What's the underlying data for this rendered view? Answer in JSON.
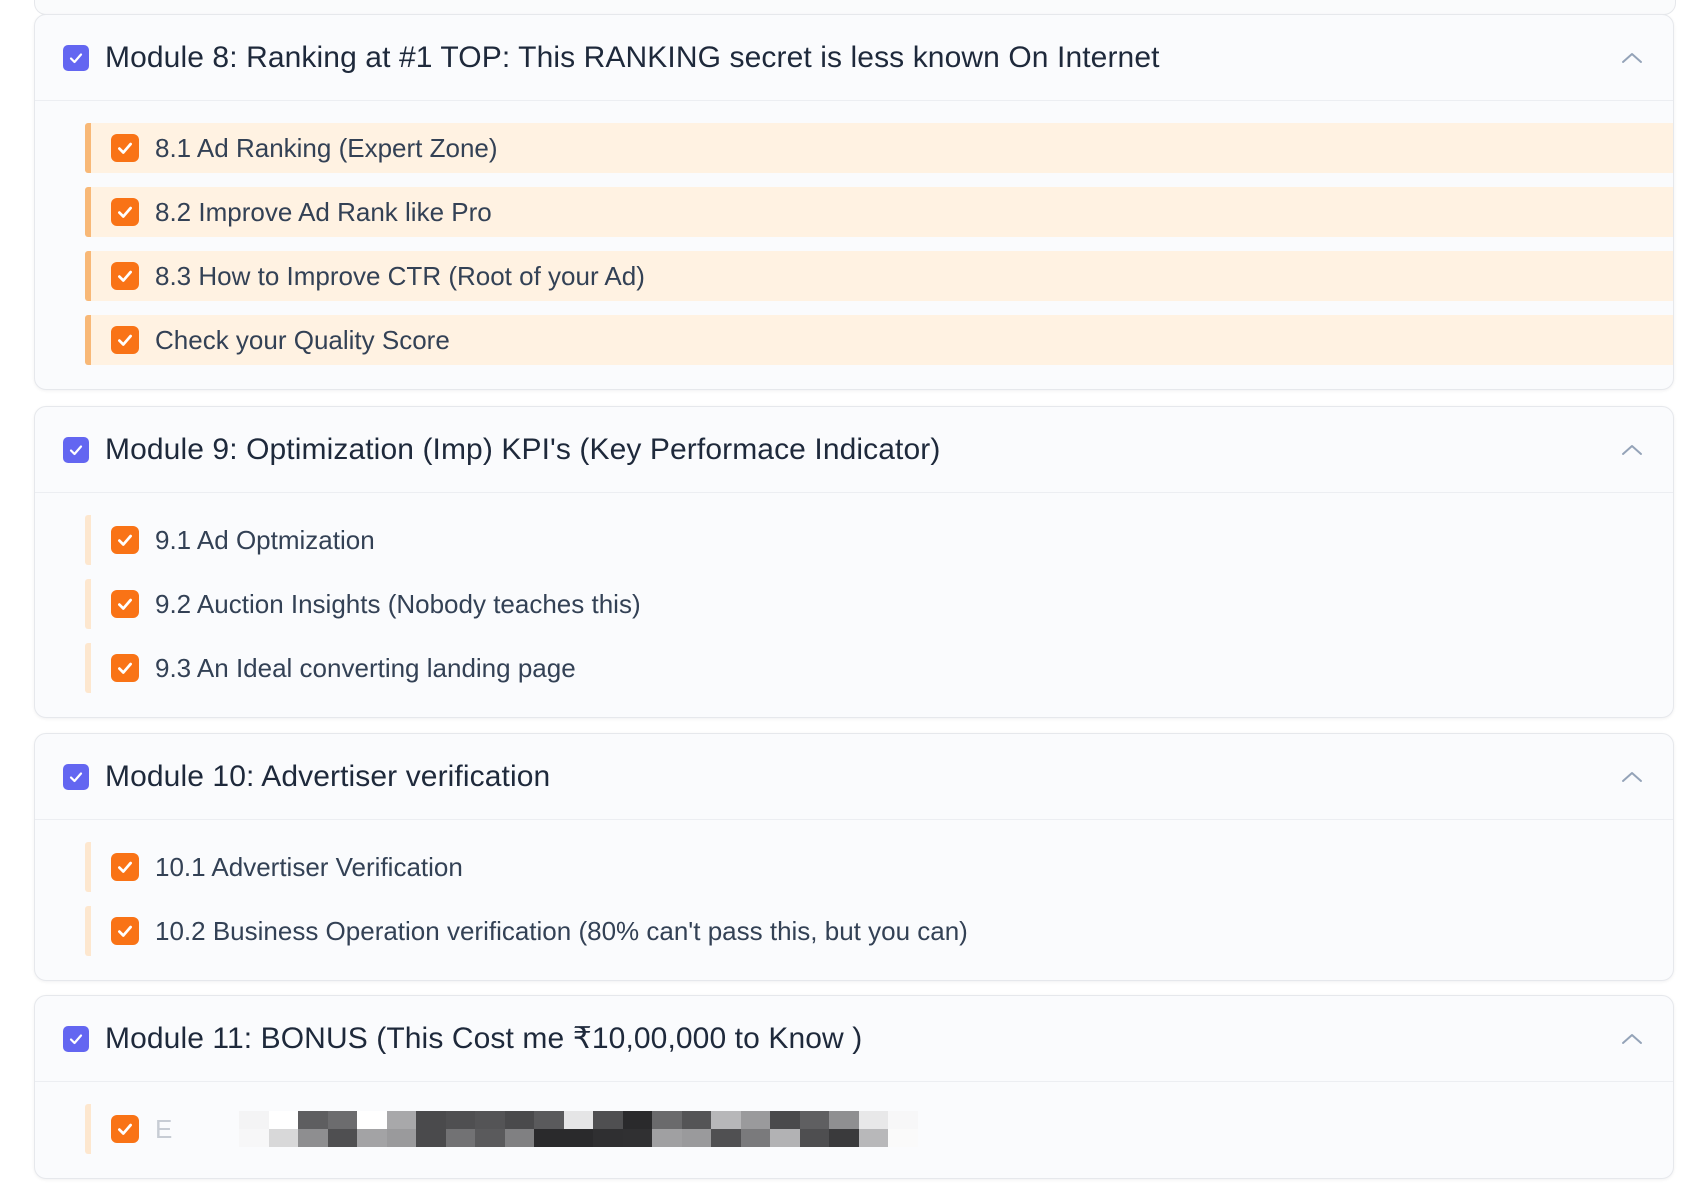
{
  "colors": {
    "module_check": "#6366f1",
    "lesson_check": "#f97316",
    "highlight_bg": "#fff2e2",
    "highlight_bar": "#f8b877"
  },
  "icons": {
    "module_check": "checkbox-checked-icon",
    "lesson_check": "checkbox-checked-icon",
    "toggle": "chevron-up-icon"
  },
  "modules": [
    {
      "title": "Module 8: Ranking at #1 TOP: This RANKING secret is less known On Internet",
      "lessons": [
        "8.1 Ad Ranking (Expert Zone)",
        "8.2 Improve Ad Rank like Pro",
        "8.3 How to Improve CTR (Root of your Ad)",
        "Check your Quality Score"
      ]
    },
    {
      "title": "Module 9: Optimization (Imp) KPI's (Key Performace Indicator)",
      "lessons": [
        "9.1 Ad Optmization",
        "9.2 Auction Insights (Nobody teaches this)",
        "9.3 An Ideal converting landing page"
      ]
    },
    {
      "title": "Module 10: Advertiser verification",
      "lessons": [
        "10.1 Advertiser Verification",
        "10.2 Business Operation verification (80% can't pass this, but you can)"
      ]
    },
    {
      "title": "Module 11: BONUS (This Cost me ₹10,00,000 to Know )",
      "lessons": [
        "E"
      ]
    }
  ]
}
